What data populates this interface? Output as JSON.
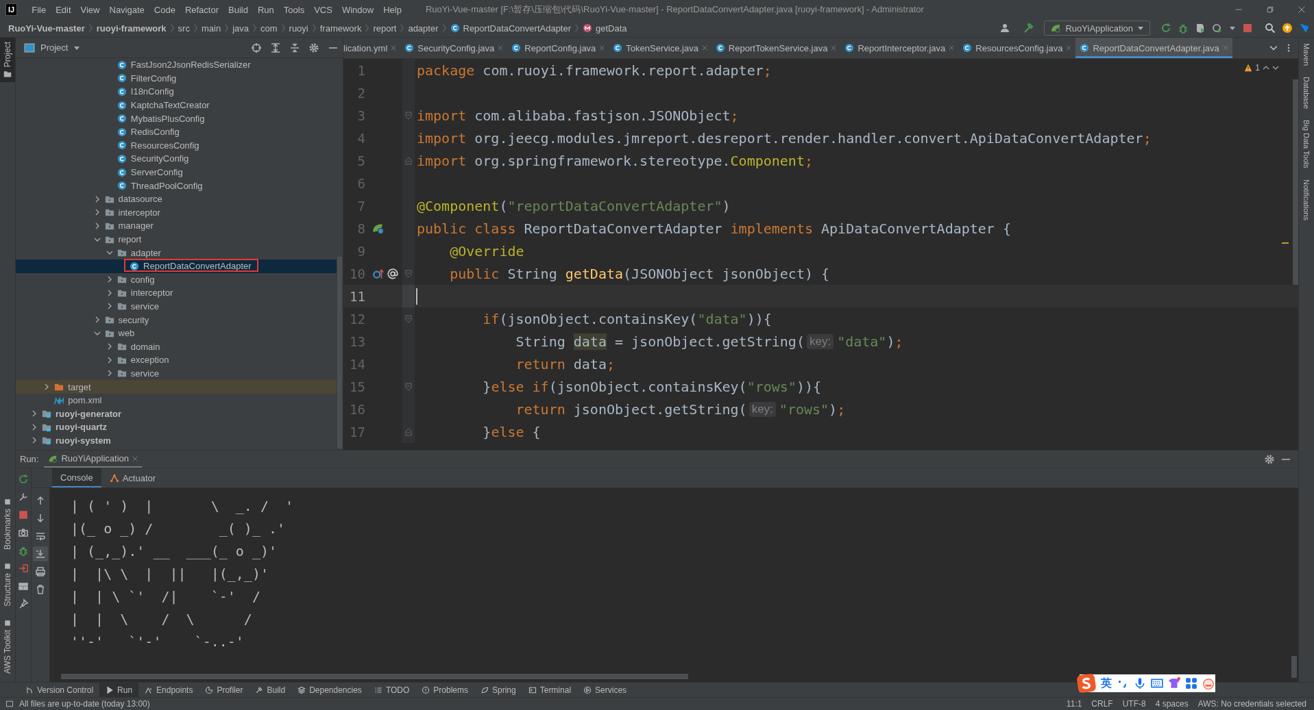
{
  "title_bar": {
    "logo": "IJ",
    "menu": [
      "File",
      "Edit",
      "View",
      "Navigate",
      "Code",
      "Refactor",
      "Build",
      "Run",
      "Tools",
      "VCS",
      "Window",
      "Help"
    ],
    "title": "RuoYi-Vue-master [F:\\暂存\\压缩包\\代码\\RuoYi-Vue-master] - ReportDataConvertAdapter.java [ruoyi-framework] - Administrator"
  },
  "breadcrumbs": [
    {
      "label": "RuoYi-Vue-master",
      "kind": "module"
    },
    {
      "label": "ruoyi-framework",
      "kind": "module"
    },
    {
      "label": "src",
      "kind": "dir"
    },
    {
      "label": "main",
      "kind": "dir"
    },
    {
      "label": "java",
      "kind": "dir"
    },
    {
      "label": "com",
      "kind": "dir"
    },
    {
      "label": "ruoyi",
      "kind": "dir"
    },
    {
      "label": "framework",
      "kind": "dir"
    },
    {
      "label": "report",
      "kind": "dir"
    },
    {
      "label": "adapter",
      "kind": "dir"
    },
    {
      "label": "ReportDataConvertAdapter",
      "kind": "class"
    },
    {
      "label": "getData",
      "kind": "method"
    }
  ],
  "run_config": {
    "label": "RuoYiApplication"
  },
  "left_strip": {
    "top": [
      {
        "label": "Project",
        "selected": true
      }
    ],
    "bottom": [
      {
        "label": "Bookmarks",
        "selected": false
      },
      {
        "label": "Structure",
        "selected": false
      },
      {
        "label": "AWS Toolkit",
        "selected": false
      }
    ]
  },
  "right_strip": [
    "Maven",
    "Database",
    "Big Data Tools",
    "Notifications"
  ],
  "project": {
    "title": "Project",
    "tree": [
      {
        "children": [
          {
            "children": [
              {
                "children": [
                  {
                    "children": [
                      {
                        "children": [
                          {
                            "children": [
                              {
                                "label": "FastJson2JsonRedisSerializer",
                                "kind": "class",
                                "selected": false
                              },
                              {
                                "label": "FilterConfig",
                                "kind": "class",
                                "selected": false
                              },
                              {
                                "label": "I18nConfig",
                                "kind": "class",
                                "selected": false
                              },
                              {
                                "label": "KaptchaTextCreator",
                                "kind": "class",
                                "selected": false
                              },
                              {
                                "label": "MybatisPlusConfig",
                                "kind": "class",
                                "selected": false
                              },
                              {
                                "label": "RedisConfig",
                                "kind": "class",
                                "selected": false
                              },
                              {
                                "label": "ResourcesConfig",
                                "kind": "class",
                                "selected": false
                              },
                              {
                                "label": "SecurityConfig",
                                "kind": "class",
                                "selected": false
                              },
                              {
                                "label": "ServerConfig",
                                "kind": "class",
                                "selected": false
                              },
                              {
                                "label": "ThreadPoolConfig",
                                "kind": "class",
                                "selected": false
                              }
                            ]
                          },
                          {
                            "label": "datasource",
                            "kind": "folder",
                            "expanded": false,
                            "selected": false
                          },
                          {
                            "label": "interceptor",
                            "kind": "folder",
                            "expanded": false,
                            "selected": false
                          },
                          {
                            "label": "manager",
                            "kind": "folder",
                            "expanded": false,
                            "selected": false
                          },
                          {
                            "label": "report",
                            "kind": "folder",
                            "expanded": true,
                            "selected": false,
                            "children": [
                              {
                                "label": "adapter",
                                "kind": "folder",
                                "expanded": true,
                                "selected": false,
                                "children": [
                                  {
                                    "label": "ReportDataConvertAdapter",
                                    "kind": "class",
                                    "selected": true,
                                    "outlined": true
                                  }
                                ]
                              },
                              {
                                "label": "config",
                                "kind": "folder",
                                "expanded": false,
                                "selected": false
                              },
                              {
                                "label": "interceptor",
                                "kind": "folder",
                                "expanded": false,
                                "selected": false
                              },
                              {
                                "label": "service",
                                "kind": "folder",
                                "expanded": false,
                                "selected": false
                              }
                            ]
                          },
                          {
                            "label": "security",
                            "kind": "folder",
                            "expanded": false,
                            "selected": false
                          },
                          {
                            "label": "web",
                            "kind": "folder",
                            "expanded": true,
                            "selected": false,
                            "children": [
                              {
                                "label": "domain",
                                "kind": "folder",
                                "expanded": false,
                                "selected": false
                              },
                              {
                                "label": "exception",
                                "kind": "folder",
                                "expanded": false,
                                "selected": false
                              },
                              {
                                "label": "service",
                                "kind": "folder",
                                "expanded": false,
                                "selected": false
                              }
                            ]
                          }
                        ]
                      }
                    ]
                  }
                ]
              }
            ]
          },
          {
            "label": "target",
            "kind": "excluded",
            "expanded": false,
            "selected": false
          },
          {
            "label": "pom.xml",
            "kind": "maven",
            "selected": false
          }
        ]
      },
      {
        "label": "ruoyi-generator",
        "kind": "module",
        "expanded": false,
        "selected": false
      },
      {
        "label": "ruoyi-quartz",
        "kind": "module",
        "expanded": false,
        "selected": false
      },
      {
        "label": "ruoyi-system",
        "kind": "module",
        "expanded": false,
        "selected": false
      }
    ]
  },
  "editor": {
    "tabs": [
      {
        "label": "lication.yml",
        "kind": "yml",
        "selected": false
      },
      {
        "label": "SecurityConfig.java",
        "kind": "class",
        "selected": false
      },
      {
        "label": "ReportConfig.java",
        "kind": "class",
        "selected": false
      },
      {
        "label": "TokenService.java",
        "kind": "class",
        "selected": false
      },
      {
        "label": "ReportTokenService.java",
        "kind": "class",
        "selected": false
      },
      {
        "label": "ReportInterceptor.java",
        "kind": "class",
        "selected": false
      },
      {
        "label": "ResourcesConfig.java",
        "kind": "class",
        "selected": false
      },
      {
        "label": "ReportDataConvertAdapter.java",
        "kind": "class",
        "selected": true
      }
    ],
    "warnings": "1",
    "lines": [
      {
        "number": "1",
        "current": false,
        "fold_start": false,
        "fold_end": false,
        "tokens": [
          {
            "kind": "keyword",
            "text": "package"
          },
          {
            "kind": "plain",
            "text": " com.ruoyi.framework.report.adapter"
          },
          {
            "kind": "keyword",
            "text": ";"
          }
        ]
      },
      {
        "number": "2",
        "current": false,
        "fold_start": false,
        "fold_end": false
      },
      {
        "number": "3",
        "current": false,
        "fold_start": true,
        "fold_end": false,
        "tokens": [
          {
            "kind": "keyword",
            "text": "import"
          },
          {
            "kind": "plain",
            "text": " com.alibaba.fastjson.JSONObject"
          },
          {
            "kind": "keyword",
            "text": ";"
          }
        ]
      },
      {
        "number": "4",
        "current": false,
        "fold_start": false,
        "fold_end": false,
        "tokens": [
          {
            "kind": "keyword",
            "text": "import"
          },
          {
            "kind": "plain",
            "text": " org.jeecg.modules.jmreport.desreport.render.handler.convert.ApiDataConvertAdapter"
          },
          {
            "kind": "keyword",
            "text": ";"
          }
        ]
      },
      {
        "number": "5",
        "current": false,
        "fold_start": false,
        "fold_end": true,
        "tokens": [
          {
            "kind": "keyword",
            "text": "import"
          },
          {
            "kind": "plain",
            "text": " org.springframework.stereotype."
          },
          {
            "kind": "annotation",
            "text": "Component"
          },
          {
            "kind": "keyword",
            "text": ";"
          }
        ]
      },
      {
        "number": "6",
        "current": false,
        "fold_start": false,
        "fold_end": false
      },
      {
        "number": "7",
        "current": false,
        "fold_start": false,
        "fold_end": false,
        "tokens": [
          {
            "kind": "annotation",
            "text": "@Component"
          },
          {
            "kind": "plain",
            "text": "("
          },
          {
            "kind": "string",
            "text": "\"reportDataConvertAdapter\""
          },
          {
            "kind": "plain",
            "text": ")"
          }
        ]
      },
      {
        "number": "8",
        "current": false,
        "fold_start": false,
        "fold_end": false,
        "gutter_icons": [
          {
            "kind": "bean"
          }
        ],
        "tokens": [
          {
            "kind": "keyword",
            "text": "public class "
          },
          {
            "kind": "plain",
            "text": "ReportDataConvertAdapter "
          },
          {
            "kind": "keyword",
            "text": "implements "
          },
          {
            "kind": "plain",
            "text": "ApiDataConvertAdapter {"
          }
        ]
      },
      {
        "number": "9",
        "current": false,
        "fold_start": false,
        "fold_end": false,
        "tokens": [
          {
            "kind": "annotation",
            "text": "    @Override"
          }
        ]
      },
      {
        "number": "10",
        "current": false,
        "fold_start": true,
        "fold_end": false,
        "gutter_icons": [
          {
            "kind": "implements"
          },
          {
            "kind": "autowire"
          }
        ],
        "tokens": [
          {
            "kind": "keyword",
            "text": "    public "
          },
          {
            "kind": "plain",
            "text": "String "
          },
          {
            "kind": "method",
            "text": "getData"
          },
          {
            "kind": "plain",
            "text": "(JSONObject jsonObject) {"
          }
        ]
      },
      {
        "number": "11",
        "current": true,
        "fold_start": false,
        "fold_end": false
      },
      {
        "number": "12",
        "current": false,
        "fold_start": true,
        "fold_end": false,
        "tokens": [
          {
            "kind": "keyword",
            "text": "        if"
          },
          {
            "kind": "plain",
            "text": "(jsonObject.containsKey("
          },
          {
            "kind": "string",
            "text": "\"data\""
          },
          {
            "kind": "plain",
            "text": ")){"
          }
        ]
      },
      {
        "number": "13",
        "current": false,
        "fold_start": false,
        "fold_end": false,
        "tokens": [
          {
            "kind": "plain",
            "text": "            String "
          },
          {
            "kind": "highlight",
            "text": "data"
          },
          {
            "kind": "plain",
            "text": " = jsonObject.getString("
          },
          {
            "kind": "hint",
            "text": "key:"
          },
          {
            "kind": "string",
            "text": "\"data\""
          },
          {
            "kind": "plain",
            "text": ")"
          },
          {
            "kind": "keyword",
            "text": ";"
          }
        ]
      },
      {
        "number": "14",
        "current": false,
        "fold_start": false,
        "fold_end": false,
        "tokens": [
          {
            "kind": "keyword",
            "text": "            return "
          },
          {
            "kind": "plain",
            "text": "data"
          },
          {
            "kind": "keyword",
            "text": ";"
          }
        ]
      },
      {
        "number": "15",
        "current": false,
        "fold_start": true,
        "fold_end": false,
        "tokens": [
          {
            "kind": "plain",
            "text": "        }"
          },
          {
            "kind": "keyword",
            "text": "else if"
          },
          {
            "kind": "plain",
            "text": "(jsonObject.containsKey("
          },
          {
            "kind": "string",
            "text": "\"rows\""
          },
          {
            "kind": "plain",
            "text": ")){"
          }
        ]
      },
      {
        "number": "16",
        "current": false,
        "fold_start": false,
        "fold_end": false,
        "tokens": [
          {
            "kind": "keyword",
            "text": "            return "
          },
          {
            "kind": "plain",
            "text": "jsonObject.getString("
          },
          {
            "kind": "hint",
            "text": "key:"
          },
          {
            "kind": "string",
            "text": "\"rows\""
          },
          {
            "kind": "plain",
            "text": ")"
          },
          {
            "kind": "keyword",
            "text": ";"
          }
        ]
      },
      {
        "number": "17",
        "current": false,
        "fold_start": false,
        "fold_end": true,
        "tokens": [
          {
            "kind": "plain",
            "text": "        }"
          },
          {
            "kind": "keyword",
            "text": "else "
          },
          {
            "kind": "plain",
            "text": "{"
          }
        ]
      }
    ]
  },
  "run": {
    "label": "Run:",
    "tab": "RuoYiApplication",
    "subtabs": [
      {
        "label": "Console",
        "kind": "console",
        "selected": true
      },
      {
        "label": "Actuator",
        "kind": "actuator",
        "selected": false
      }
    ],
    "console": [
      "| ( ' )  |       \\  _. /  '",
      "|(_ o _) /        _( )_ .'",
      "| (_,_).' __  ___(_ o _)'",
      "|  |\\ \\  |  ||   |(_,_)'",
      "|  | \\ `'  /|    `-'  /",
      "|  |  \\    /  \\      /",
      "''-'   `'-'    `-..-'"
    ]
  },
  "tool_tabs": [
    {
      "label": "Version Control",
      "kind": "vcs",
      "selected": false
    },
    {
      "label": "Run",
      "kind": "run",
      "selected": true
    },
    {
      "label": "Endpoints",
      "kind": "endpoints",
      "selected": false
    },
    {
      "label": "Profiler",
      "kind": "profiler",
      "selected": false
    },
    {
      "label": "Build",
      "kind": "build",
      "selected": false
    },
    {
      "label": "Dependencies",
      "kind": "dependencies",
      "selected": false
    },
    {
      "label": "TODO",
      "kind": "todo",
      "selected": false
    },
    {
      "label": "Problems",
      "kind": "problems",
      "selected": false
    },
    {
      "label": "Spring",
      "kind": "spring",
      "selected": false
    },
    {
      "label": "Terminal",
      "kind": "terminal",
      "selected": false
    },
    {
      "label": "Services",
      "kind": "services",
      "selected": false
    }
  ],
  "status": {
    "message": "All files are up-to-date (today 13:00)",
    "items": [
      "11:1",
      "CRLF",
      "UTF-8",
      "4 spaces",
      "AWS: No credentials selected"
    ]
  },
  "ime": {
    "label": "英"
  }
}
